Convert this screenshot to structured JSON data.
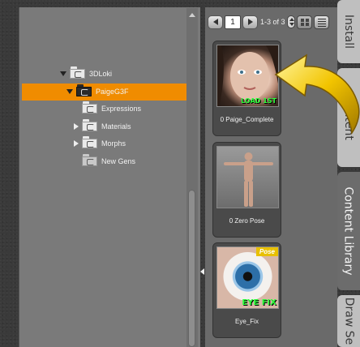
{
  "tree": {
    "items": [
      {
        "label": "3DLoki",
        "expand": "down",
        "icon": "folder-icon"
      },
      {
        "label": "PaigeG3F",
        "expand": "down",
        "icon": "folder-open-icon",
        "selected": true
      },
      {
        "label": "Expressions",
        "expand": "none",
        "icon": "folder-icon"
      },
      {
        "label": "Materials",
        "expand": "right",
        "icon": "folder-icon"
      },
      {
        "label": "Morphs",
        "expand": "right",
        "icon": "folder-icon"
      },
      {
        "label": "New Gens",
        "expand": "none",
        "icon": "folder-faded-icon"
      }
    ],
    "selected_color": "#f08c00"
  },
  "pager": {
    "current_page": "1",
    "range": "1-3 of 3"
  },
  "cards": [
    {
      "label": "0 Paige_Complete",
      "tag": "LOAD 1ST",
      "thumb": "face-portrait"
    },
    {
      "label": "0 Zero Pose",
      "tag": "",
      "thumb": "figure-t-pose"
    },
    {
      "label": "Eye_Fix",
      "tag": "EYE FIX",
      "badge": "Pose",
      "thumb": "eye-closeup"
    }
  ],
  "tabs": [
    {
      "label": "Install",
      "active": false
    },
    {
      "label": "Content",
      "active": false
    },
    {
      "label": "Content Library",
      "active": true
    },
    {
      "label": "Draw Se",
      "active": false
    }
  ],
  "colors": {
    "accent": "#f08c00",
    "tag_green": "#2aff3a",
    "arrow_yellow": "#f2c400"
  }
}
